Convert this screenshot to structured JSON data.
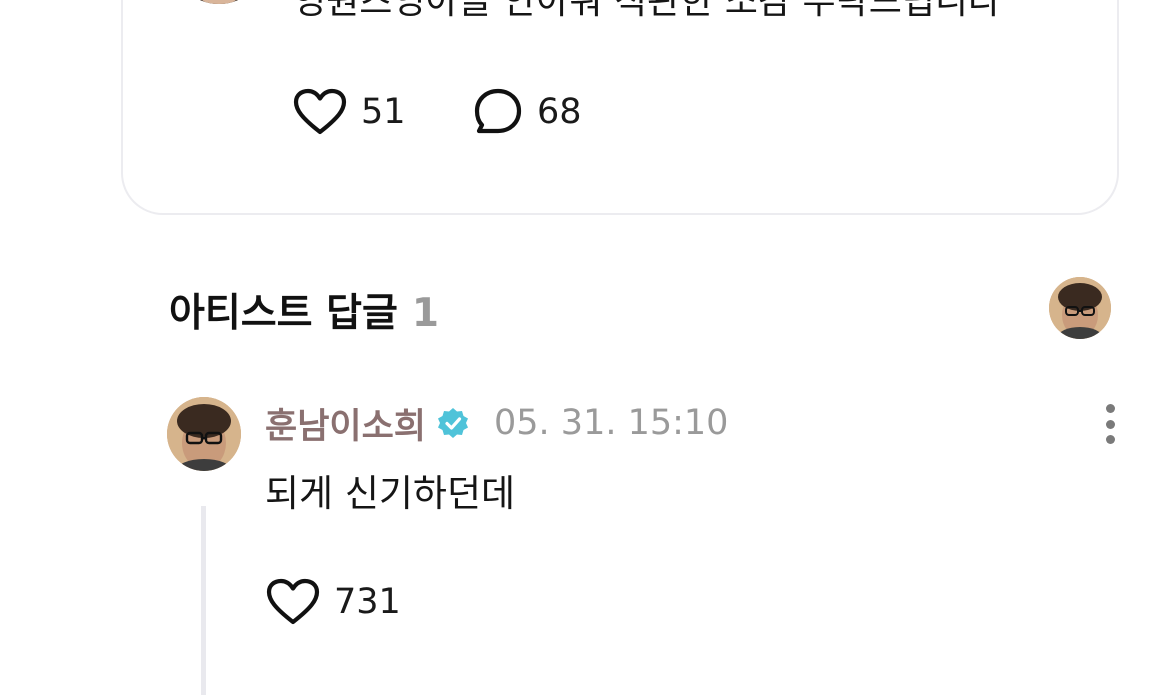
{
  "post": {
    "text": "영원즈엉아들 안아줘 직관한 소감 부탁드립니다",
    "like_count": "51",
    "comment_count": "68",
    "icons": {
      "like": "heart-icon",
      "comment": "speech-bubble-icon"
    }
  },
  "artist_replies": {
    "title": "아티스트 답글",
    "count": "1"
  },
  "reply": {
    "author": "훈남이소희",
    "verified_icon": "verified-badge-icon",
    "timestamp": "05. 31. 15:10",
    "text": "되게 신기하던데",
    "like_count": "731",
    "icons": {
      "like": "heart-icon",
      "more": "more-vertical-icon"
    }
  },
  "colors": {
    "author_name": "#8a7070",
    "verified_badge": "#4fc3d9",
    "muted_text": "#9a9a9a",
    "card_border": "#ececf0",
    "thread_line": "#e9e9ee"
  }
}
